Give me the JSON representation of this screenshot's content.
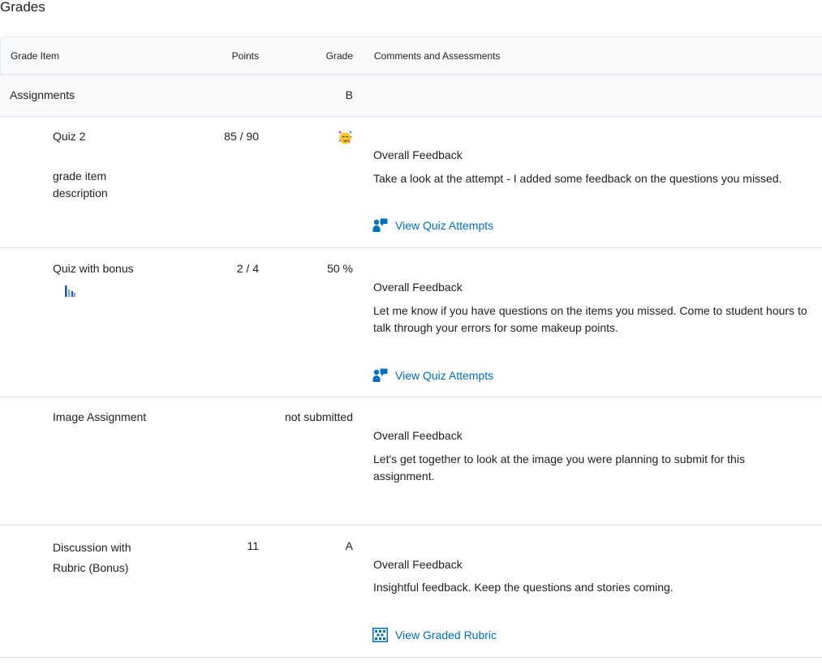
{
  "page": {
    "title": "Grades"
  },
  "table": {
    "headers": {
      "grade_item": "Grade Item",
      "points": "Points",
      "grade": "Grade",
      "comments": "Comments and Assessments"
    },
    "category": {
      "name": "Assignments",
      "grade": "B"
    },
    "rows": [
      {
        "name": "Quiz 2",
        "description": "grade item description",
        "points": "85 / 90",
        "grade_icon": "party-face-emoji-icon",
        "feedback_title": "Overall Feedback",
        "feedback": "Take a look at the attempt - I added some feedback on the questions you missed.",
        "link": "View Quiz Attempts",
        "link_icon": "quiz-attempts-icon"
      },
      {
        "name": "Quiz with bonus",
        "stats_icon": "bar-chart-icon",
        "points": "2 / 4",
        "grade": "50 %",
        "feedback_title": "Overall Feedback",
        "feedback": "Let me know if you have questions on the items you missed. Come to student hours to talk through your errors for some makeup points.",
        "link": "View Quiz Attempts",
        "link_icon": "quiz-attempts-icon"
      },
      {
        "name": "Image Assignment",
        "grade": "not submitted",
        "feedback_title": "Overall Feedback",
        "feedback": "Let's get together to look at the image you were planning to submit for this assignment."
      },
      {
        "name": "Discussion with Rubric (Bonus)",
        "points": "11",
        "grade": "A",
        "feedback_title": "Overall Feedback",
        "feedback": "Insightful feedback. Keep the questions and stories coming.",
        "link": "View Graded Rubric",
        "link_icon": "rubric-icon"
      }
    ]
  },
  "colors": {
    "link": "#006fbf",
    "header_bg": "#f9fafb",
    "border": "#d9dee6",
    "text": "#202122"
  }
}
